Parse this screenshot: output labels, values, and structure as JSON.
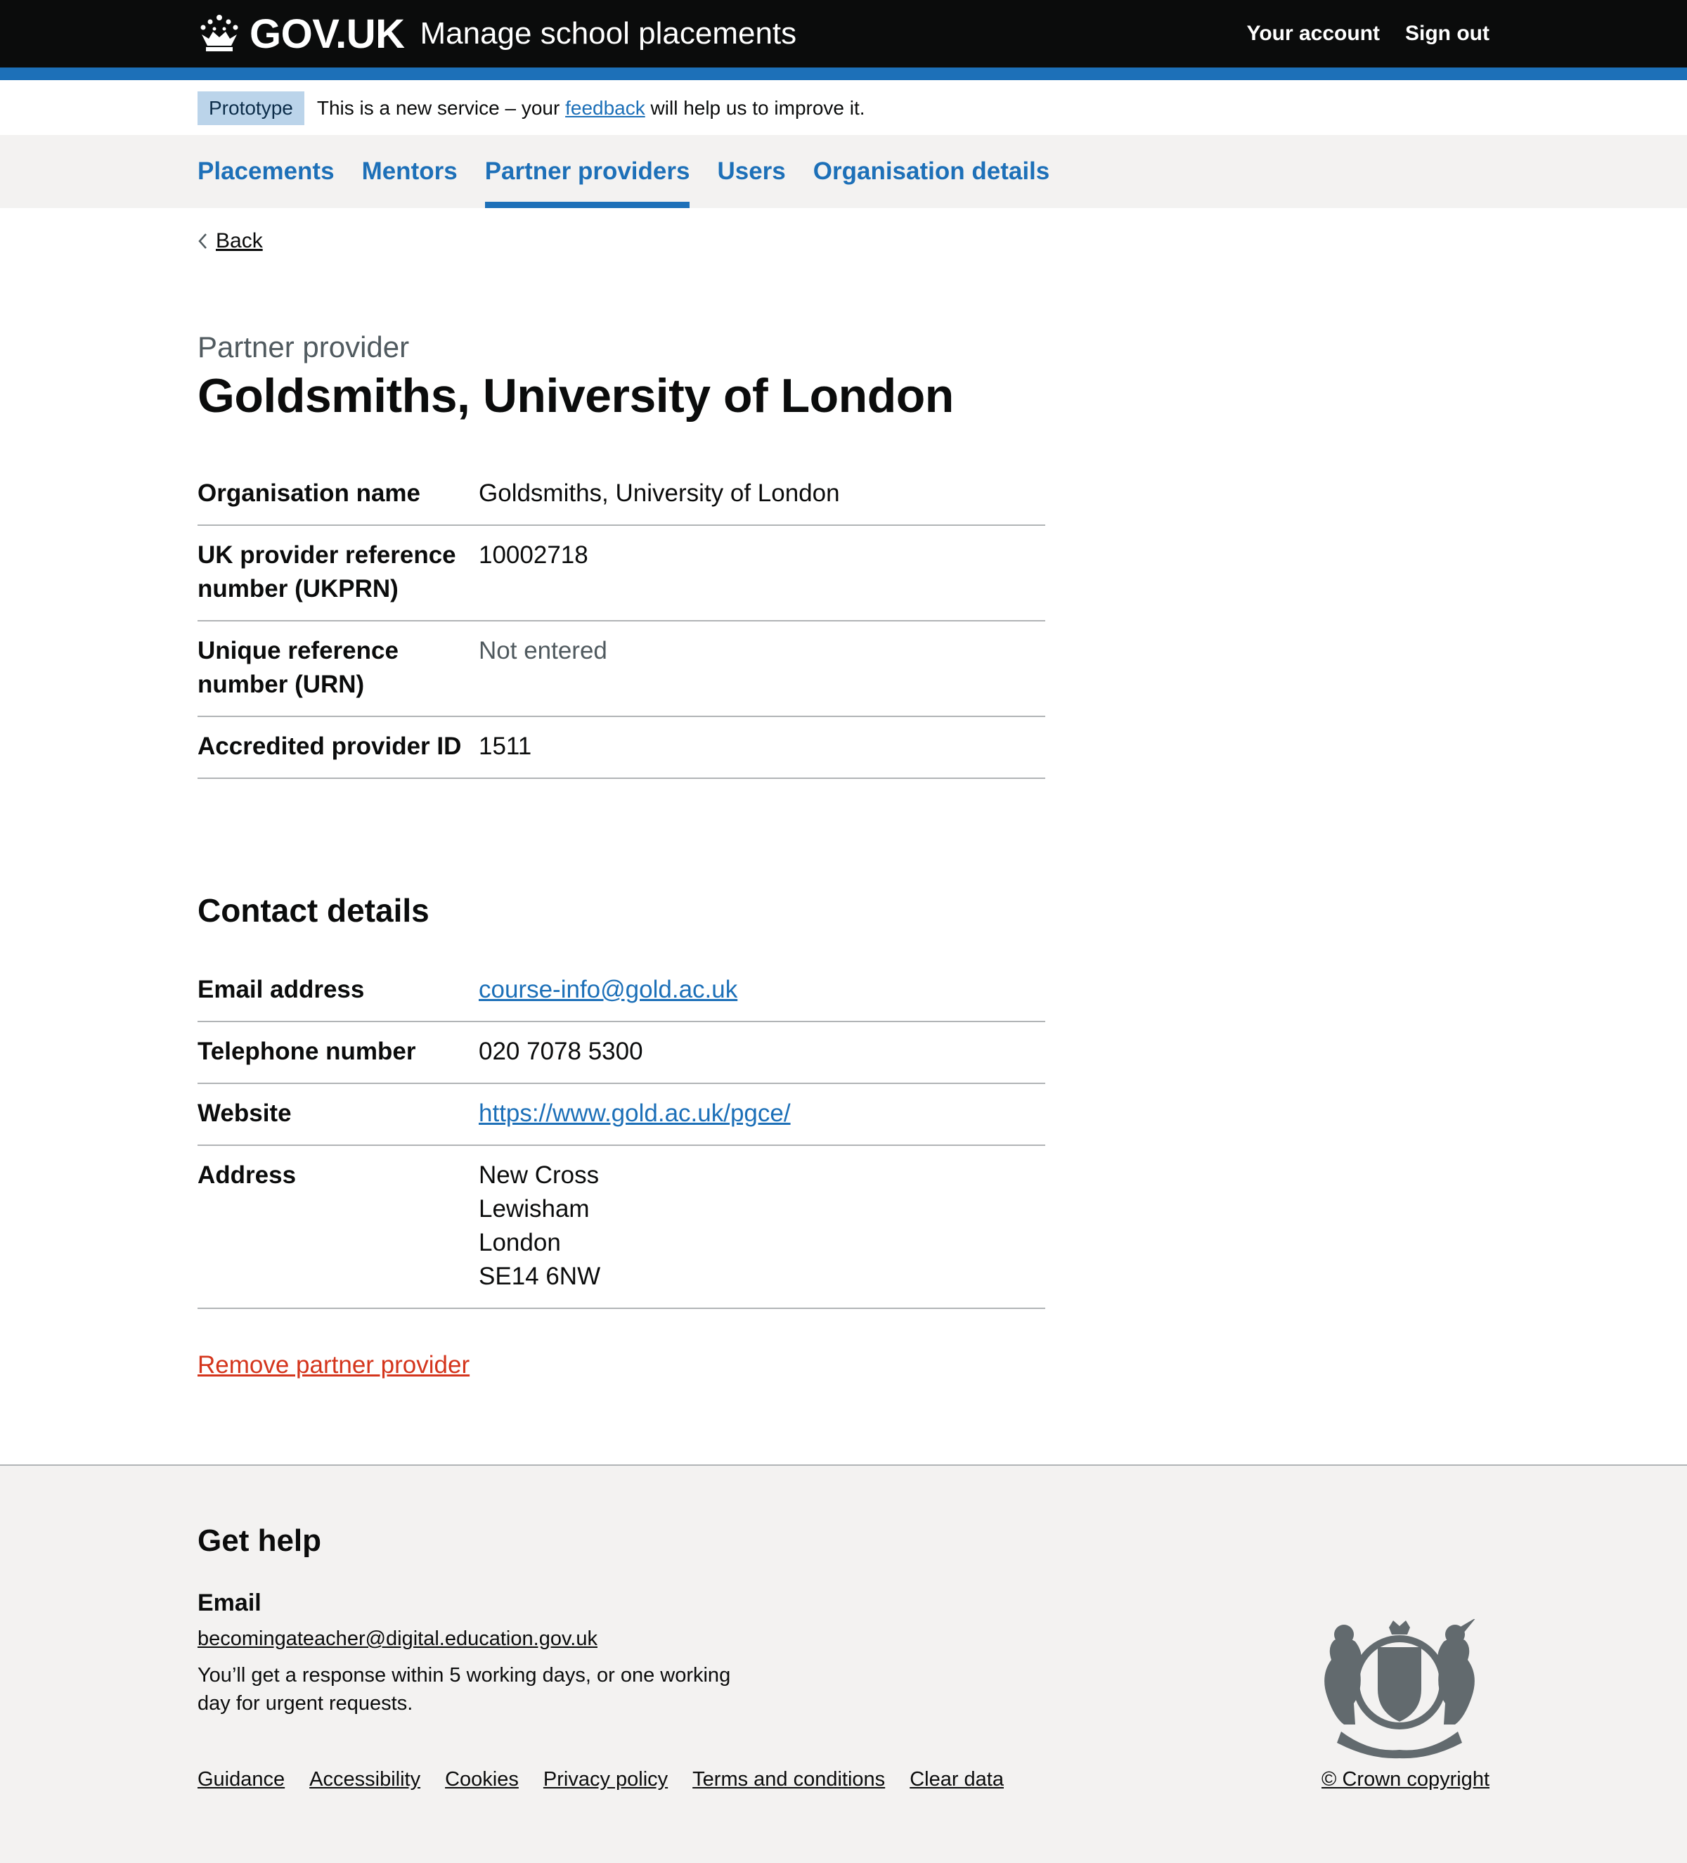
{
  "header": {
    "logo_text": "GOV.UK",
    "service_name": "Manage school placements",
    "links": [
      "Your account",
      "Sign out"
    ]
  },
  "phase_banner": {
    "tag": "Prototype",
    "text_before": "This is a new service – your",
    "link": "feedback",
    "text_after": "will help us to improve it."
  },
  "nav": {
    "items": [
      {
        "label": "Placements",
        "active": false
      },
      {
        "label": "Mentors",
        "active": false
      },
      {
        "label": "Partner providers",
        "active": true
      },
      {
        "label": "Users",
        "active": false
      },
      {
        "label": "Organisation details",
        "active": false
      }
    ]
  },
  "back": {
    "label": "Back"
  },
  "page": {
    "caption": "Partner provider",
    "title": "Goldsmiths, University of London"
  },
  "summary": [
    {
      "key": "Organisation name",
      "value": "Goldsmiths, University of London"
    },
    {
      "key": "UK provider reference number (UKPRN)",
      "value": "10002718"
    },
    {
      "key": "Unique reference number (URN)",
      "value": "Not entered"
    },
    {
      "key": "Accredited provider ID",
      "value": "1511"
    }
  ],
  "contact": {
    "heading": "Contact details",
    "email_label": "Email address",
    "email": "course-info@gold.ac.uk",
    "phone_label": "Telephone number",
    "phone": "020 7078 5300",
    "website_label": "Website",
    "website": "https://www.gold.ac.uk/pgce/",
    "address_label": "Address",
    "address": [
      "New Cross",
      "Lewisham",
      "London",
      "SE14 6NW"
    ]
  },
  "remove_link": "Remove partner provider",
  "footer": {
    "heading": "Get help",
    "email_heading": "Email",
    "email": "becomingateacher@digital.education.gov.uk",
    "note": "You’ll get a response within 5 working days, or one working day for urgent requests.",
    "links": [
      "Guidance",
      "Accessibility",
      "Cookies",
      "Privacy policy",
      "Terms and conditions",
      "Clear data"
    ],
    "copyright": "© Crown copyright"
  },
  "colors": {
    "header_bg": "#0b0c0c",
    "brand_blue": "#1d70b8",
    "tag_bg": "#bbd4ea",
    "nav_bg": "#f3f2f1",
    "danger": "#d4351c",
    "border": "#b1b4b6"
  }
}
